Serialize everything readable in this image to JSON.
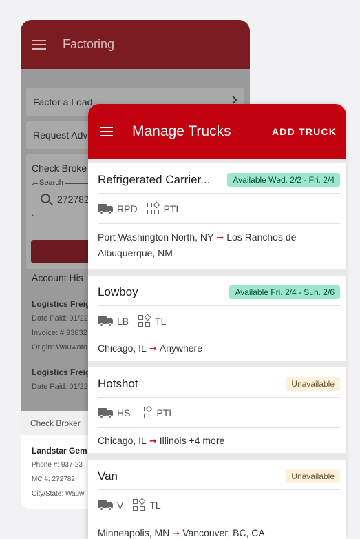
{
  "factoring": {
    "title": "Factoring",
    "menu": [
      "Factor a Load",
      "Request Adv"
    ],
    "check_broker": {
      "title": "Check Broke",
      "search_label": "Search",
      "search_value": "272782"
    },
    "history": {
      "title": "Account His",
      "items": [
        {
          "name": "Logistics Freig",
          "date": "Date Paid: 01/22",
          "invoice": "Invoice: # 93832",
          "origin": "Origin: Wauwato"
        },
        {
          "name": "Logistics Freig",
          "date": "Date Paid: 01/22"
        }
      ]
    },
    "bottom_sheet": {
      "header": "Check Broker",
      "name": "Landstar Gem",
      "phone": "Phone #: 937-23",
      "mc": "MC #: 272782",
      "city": "City/State: Wauw"
    }
  },
  "trucks": {
    "title": "Manage Trucks",
    "add_label": "ADD TRUCK",
    "items": [
      {
        "name": "Refrigerated Carrier...",
        "status": "Available Wed. 2/2 - Fri. 2/4",
        "status_type": "available",
        "truck_code": "RPD",
        "load_type": "PTL",
        "origin": "Port Washington North, NY",
        "destination": "Los Ranchos de Albuquerque, NM"
      },
      {
        "name": "Lowboy",
        "status": "Available Fri. 2/4 - Sun. 2/6",
        "status_type": "available",
        "truck_code": "LB",
        "load_type": "TL",
        "origin": "Chicago, IL",
        "destination": "Anywhere"
      },
      {
        "name": "Hotshot",
        "status": "Unavailable",
        "status_type": "unavailable",
        "truck_code": "HS",
        "load_type": "PTL",
        "origin": "Chicago, IL",
        "destination": "Illinois +4 more"
      },
      {
        "name": "Van",
        "status": "Unavailable",
        "status_type": "unavailable",
        "truck_code": "V",
        "load_type": "TL",
        "origin": "Minneapolis, MN",
        "destination": "Vancouver, BC, CA"
      }
    ]
  },
  "colors": {
    "brand_red": "#c0030e",
    "dark_red": "#7b1c22",
    "available_bg": "#9de8cd",
    "unavailable_bg": "#fdf1dc"
  }
}
